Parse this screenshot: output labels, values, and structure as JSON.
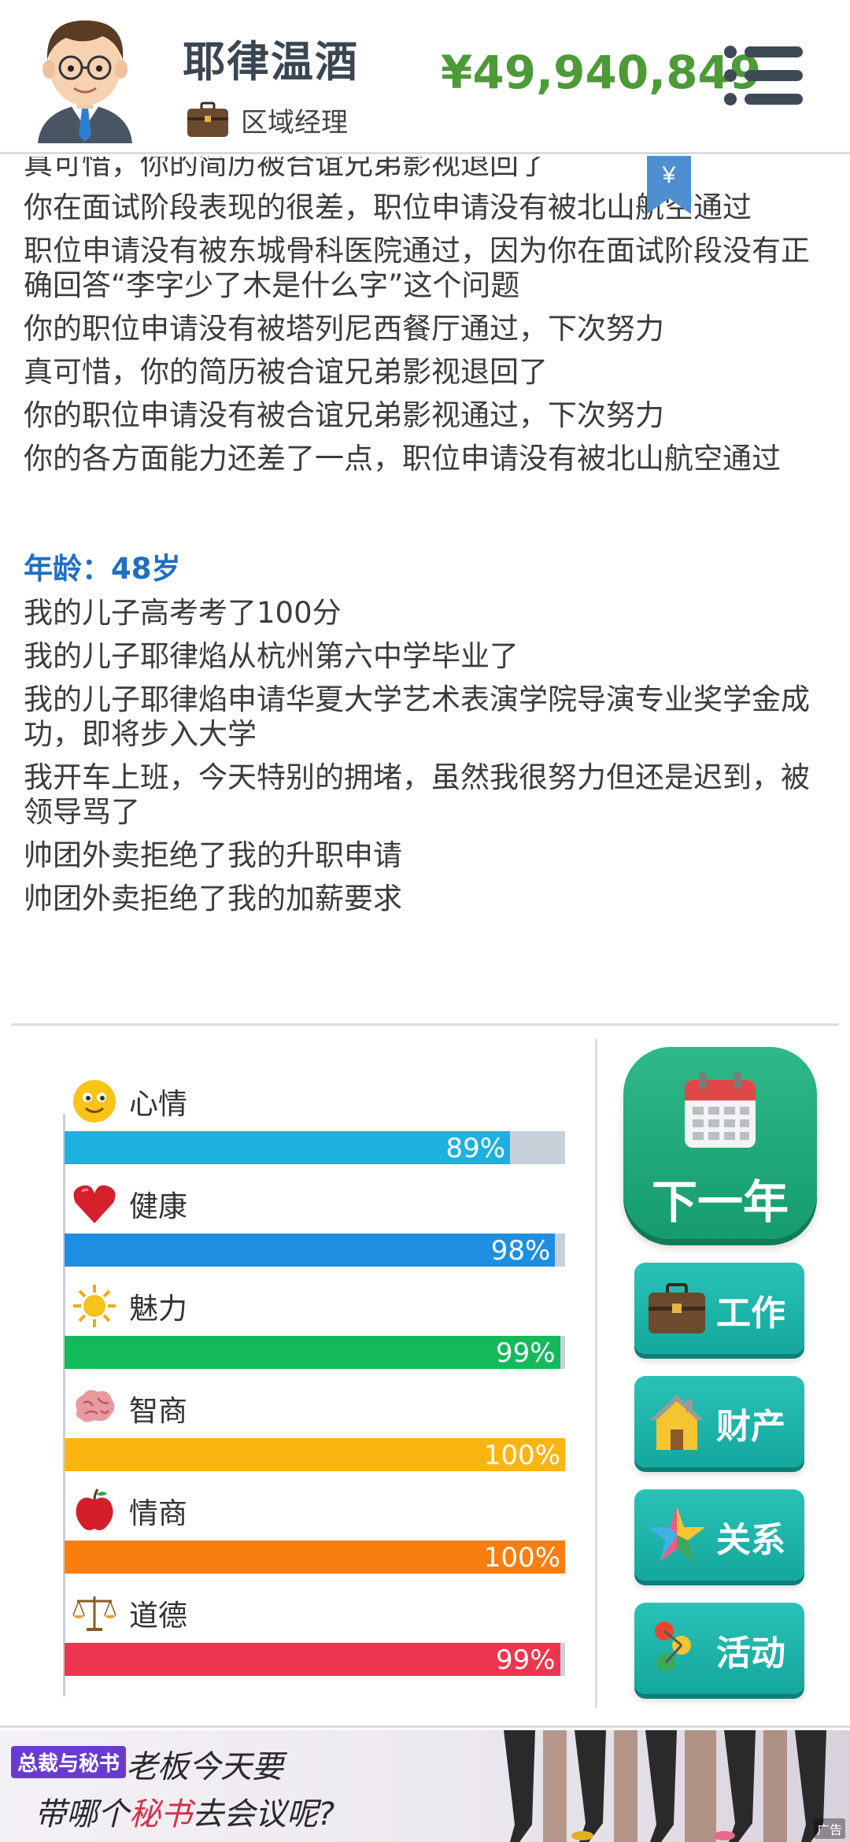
{
  "header": {
    "name": "耶律温酒",
    "job_title": "区域经理",
    "money": "¥49,940,849",
    "bookmark_symbol": "¥"
  },
  "log": {
    "lines_before": [
      "真可惜，你的简历被合谊兄弟影视退回了",
      "你在面试阶段表现的很差，职位申请没有被北山航空通过",
      "职位申请没有被东城骨科医院通过，因为你在面试阶段没有正确回答“李字少了木是什么字”这个问题",
      "你的职位申请没有被塔列尼西餐厅通过，下次努力",
      "真可惜，你的简历被合谊兄弟影视退回了",
      "你的职位申请没有被合谊兄弟影视通过，下次努力",
      "你的各方面能力还差了一点，职位申请没有被北山航空通过"
    ],
    "age_label": "年龄：48岁",
    "lines_after": [
      "我的儿子高考考了100分",
      "我的儿子耶律焰从杭州第六中学毕业了",
      "我的儿子耶律焰申请华夏大学艺术表演学院导演专业奖学金成功，即将步入大学",
      "我开车上班，今天特别的拥堵，虽然我很努力但还是迟到，被领导骂了",
      "帅团外卖拒绝了我的升职申请",
      "帅团外卖拒绝了我的加薪要求"
    ]
  },
  "stats": [
    {
      "label": "心情",
      "value": 89,
      "pct": "89%",
      "color": "#1fb1dd",
      "icon": "smiley-icon"
    },
    {
      "label": "健康",
      "value": 98,
      "pct": "98%",
      "color": "#1e8ee0",
      "icon": "heart-icon"
    },
    {
      "label": "魅力",
      "value": 99,
      "pct": "99%",
      "color": "#14b95a",
      "icon": "sun-icon"
    },
    {
      "label": "智商",
      "value": 100,
      "pct": "100%",
      "color": "#fbb511",
      "icon": "brain-icon"
    },
    {
      "label": "情商",
      "value": 100,
      "pct": "100%",
      "color": "#f97e0f",
      "icon": "apple-icon"
    },
    {
      "label": "道德",
      "value": 99,
      "pct": "99%",
      "color": "#ec364f",
      "icon": "scale-icon"
    }
  ],
  "buttons": {
    "next_year": "下一年",
    "work": "工作",
    "property": "财产",
    "relations": "关系",
    "activities": "活动"
  },
  "ad": {
    "logo": "总裁与秘书",
    "line1": "老板今天要",
    "line2_a": "带哪个",
    "line2_hl": "秘书",
    "line2_b": "去会议呢?",
    "tag": "广告"
  }
}
